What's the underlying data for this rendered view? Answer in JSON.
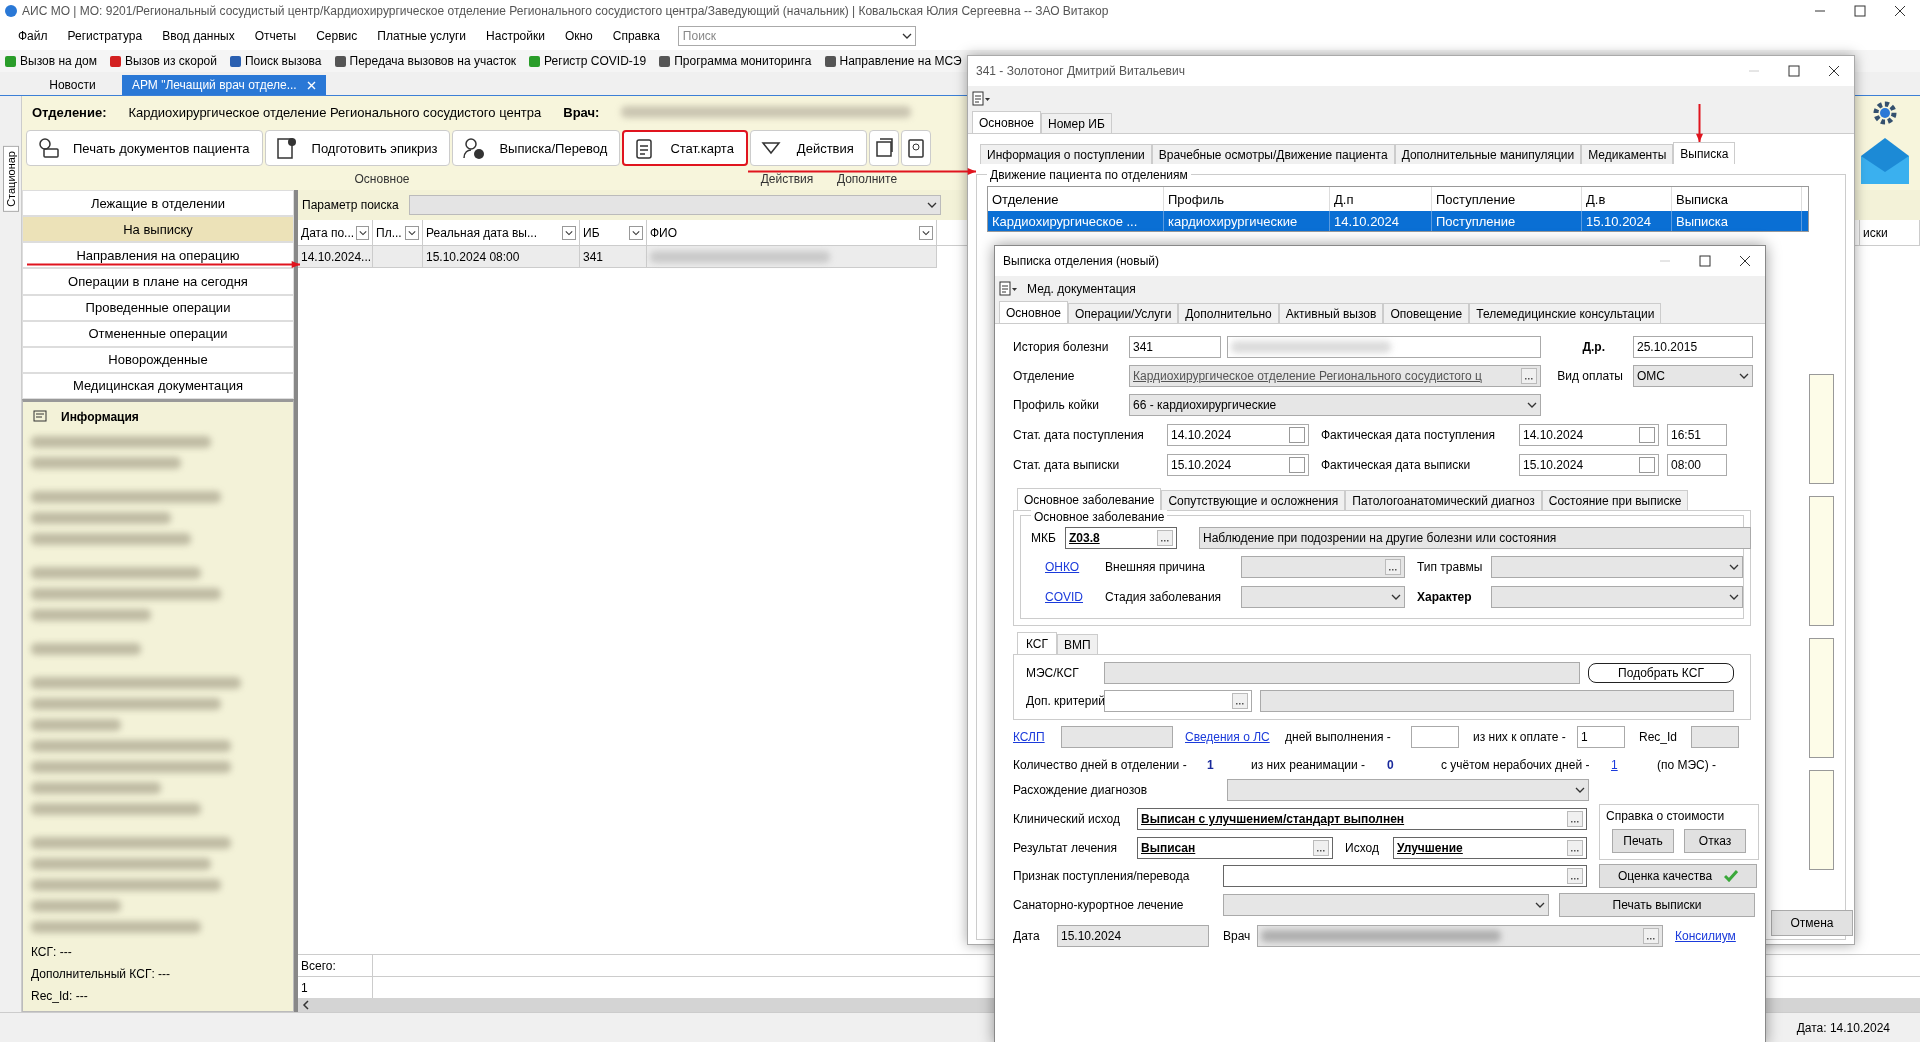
{
  "main_window": {
    "title": "АИС МО | МО: 9201/Региональный сосудистый центр/Кардиохирургическое отделение Регионального сосудистого центра/Заведующий (начальник) | Ковальская Юлия Сергеевна -- ЗАО Витакор",
    "menu": [
      "Файл",
      "Регистратура",
      "Ввод данных",
      "Отчеты",
      "Сервис",
      "Платные услуги",
      "Настройки",
      "Окно",
      "Справка"
    ],
    "search_placeholder": "Поиск",
    "toolbar": [
      "Вызов на дом",
      "Вызов из скорой",
      "Поиск вызова",
      "Передача вызовов на участок",
      "Регистр COVID-19",
      "Программа мониторинга",
      "Направление на МСЭ"
    ],
    "tabs": [
      {
        "label": "Новости",
        "selected": false,
        "closable": false
      },
      {
        "label": "АРМ \"Лечащий врач отделе...",
        "selected": true,
        "closable": true
      }
    ],
    "side_tab": "Стационар",
    "department_label": "Отделение:",
    "department": "Кардиохирургическое отделение Регионального сосудистого центра",
    "doctor_label": "Врач:",
    "actions": [
      {
        "label": "Печать документов пациента",
        "highlighted": false
      },
      {
        "label": "Подготовить эпикриз",
        "highlighted": false
      },
      {
        "label": "Выписка/Перевод",
        "highlighted": false
      },
      {
        "label": "Стат.карта",
        "highlighted": true
      },
      {
        "label": "Действия",
        "highlighted": false
      }
    ],
    "section_labels": [
      "Основное",
      "Действия",
      "Дополните"
    ],
    "nav": [
      {
        "label": "Лежащие в отделении",
        "selected": false
      },
      {
        "label": "На выписку",
        "selected": true
      },
      {
        "label": "Направления на операцию",
        "selected": false
      },
      {
        "label": "Операции в плане на сегодня",
        "selected": false
      },
      {
        "label": "Проведенные операции",
        "selected": false
      },
      {
        "label": "Отмененные операции",
        "selected": false
      },
      {
        "label": "Новорожденные",
        "selected": false
      },
      {
        "label": "Медицинская документация",
        "selected": false
      }
    ],
    "info": {
      "title": "Информация",
      "lines": [
        "КСГ: ---",
        "Дополнительный КСГ: ---",
        "Rec_Id: ---"
      ]
    },
    "grid": {
      "search_label": "Параметр поиска",
      "columns": [
        "Дата по...",
        "Пл...",
        "Реальная дата вы...",
        "ИБ",
        "ФИО",
        "иски"
      ],
      "rows": [
        {
          "admission": "14.10.2024...",
          "discharge": "15.10.2024 08:00",
          "case_number": "341",
          "selected": true
        }
      ],
      "total_label": "Всего:",
      "total": "1"
    },
    "status": "Дата: 14.10.2024"
  },
  "patient_window": {
    "title": "341 - Золотоног Дмитрий Витальевич",
    "tabs": [
      {
        "label": "Основное",
        "selected": true
      },
      {
        "label": "Номер ИБ",
        "selected": false
      }
    ],
    "subtabs": [
      {
        "label": "Информация о поступлении",
        "selected": false
      },
      {
        "label": "Врачебные осмотры/Движение пациента",
        "selected": false
      },
      {
        "label": "Дополнительные манипуляции",
        "selected": false
      },
      {
        "label": "Медикаменты",
        "selected": false
      },
      {
        "label": "Выписка",
        "selected": true
      }
    ],
    "group": "Движение пациента по отделениям",
    "columns": [
      "Отделение",
      "Профиль",
      "Д.п",
      "Поступление",
      "Д.в",
      "Выписка"
    ],
    "rows": [
      {
        "cells": [
          "Кардиохирургическое ...",
          "кардиохирургические",
          "14.10.2024",
          "Поступление",
          "15.10.2024",
          "Выписка"
        ],
        "selected": true
      }
    ],
    "cancel": "Отмена"
  },
  "discharge_dialog": {
    "title": "Выписка отделения (новый)",
    "toolbar_label": "Мед. документация",
    "tabs": [
      {
        "label": "Основное",
        "selected": true
      },
      {
        "label": "Операции/Услуги",
        "selected": false
      },
      {
        "label": "Дополнительно",
        "selected": false
      },
      {
        "label": "Активный вызов",
        "selected": false
      },
      {
        "label": "Оповещение",
        "selected": false
      },
      {
        "label": "Телемедицинские консультации",
        "selected": false
      }
    ],
    "case_history": {
      "label": "История болезни",
      "value": "341"
    },
    "birth_date": {
      "label": "Д.р.",
      "value": "25.10.2015"
    },
    "department": {
      "label": "Отделение",
      "value": "Кардиохирургическое отделение Регионального сосудистого ц"
    },
    "payment": {
      "label": "Вид оплаты",
      "value": "ОМС"
    },
    "bed_profile": {
      "label": "Профиль койки",
      "value": "66 - кардиохирургические"
    },
    "stat_admission": {
      "label": "Стат. дата поступления",
      "value": "14.10.2024"
    },
    "actual_admission": {
      "label": "Фактическая дата поступления",
      "value": "14.10.2024",
      "time": "16:51"
    },
    "stat_discharge": {
      "label": "Стат. дата выписки",
      "value": "15.10.2024"
    },
    "actual_discharge": {
      "label": "Фактическая дата выписки",
      "value": "15.10.2024",
      "time": "08:00"
    },
    "diagnosis_tabs": [
      {
        "label": "Основное заболевание",
        "selected": true
      },
      {
        "label": "Сопутствующие и осложнения",
        "selected": false
      },
      {
        "label": "Патологоанатомический диагноз",
        "selected": false
      },
      {
        "label": "Состояние при выписке",
        "selected": false
      }
    ],
    "diagnosis_group": "Основное заболевание",
    "mkb_label": "МКБ",
    "mkb_code": "Z03.8",
    "mkb_name": "Наблюдение при подозрении на другие болезни или состояния",
    "onko": "ОНКО",
    "external_cause": "Внешняя причина",
    "injury_type": "Тип травмы",
    "covid": "COVID",
    "stage": "Стадия заболевания",
    "character": "Характер",
    "ksg_tabs": [
      {
        "label": "КСГ",
        "selected": true
      },
      {
        "label": "ВМП",
        "selected": false
      }
    ],
    "mes_label": "МЭС/КСГ",
    "pick_ksg": "Подобрать КСГ",
    "extra_criterion": "Доп. критерий",
    "kslp": "КСЛП",
    "drug_info": "Сведения о ЛС",
    "days_done": "дней выполнения -",
    "paid_label": "из них к оплате -",
    "paid_value": "1",
    "rec_id": "Rec_Id",
    "days_label": "Количество дней в отделении -",
    "days_value": "1",
    "icu_label": "из них реанимации -",
    "icu_value": "0",
    "nonwork_label": "с учётом нерабочих дней -",
    "nonwork_value": "1",
    "mes_days": "(по МЭС) -",
    "mismatch": "Расхождение диагнозов",
    "clinical_outcome": {
      "label": "Клинический исход",
      "value": "Выписан с улучшением/стандарт выполнен"
    },
    "cost_group": "Справка о стоимости",
    "print": "Печать",
    "refuse": "Отказ",
    "result": {
      "label": "Результат лечения",
      "value": "Выписан"
    },
    "outcome": {
      "label": "Исход",
      "value": "Улучшение"
    },
    "transfer": "Признак поступления/перевода",
    "quality": "Оценка качества",
    "quality_ok": true,
    "sanatorium": "Санаторно-курортное лечение",
    "print_discharge": "Печать выписки",
    "date": {
      "label": "Дата",
      "value": "15.10.2024"
    },
    "doctor_label": "Врач",
    "consilium": "Консилиум"
  }
}
